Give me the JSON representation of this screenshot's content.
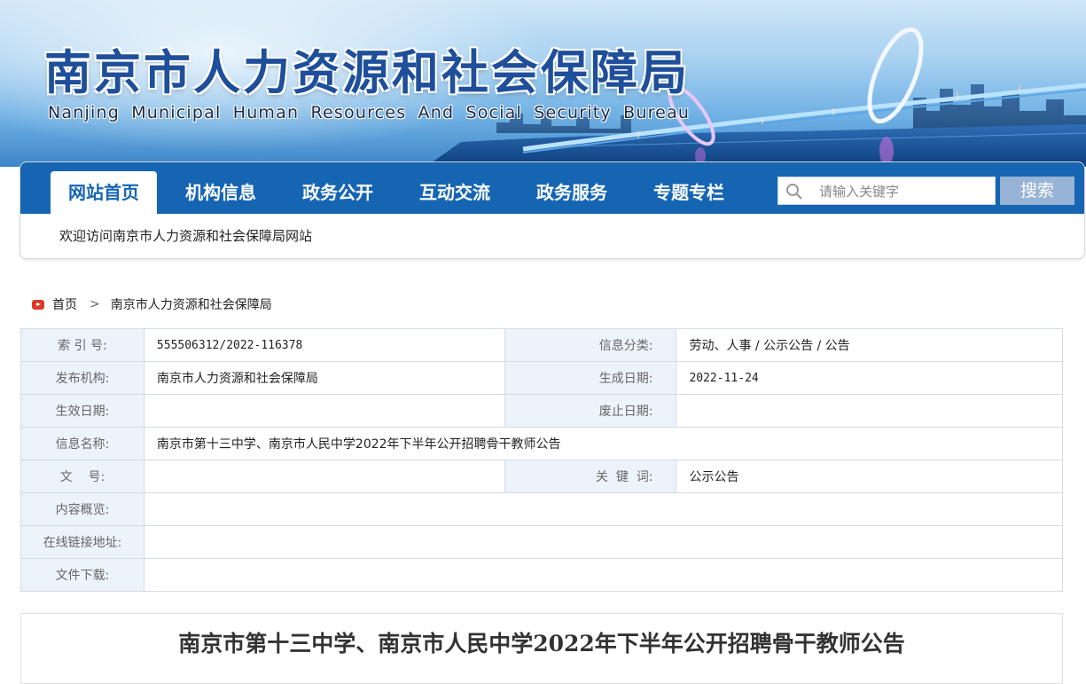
{
  "site": {
    "title_zh": "南京市人力资源和社会保障局",
    "title_en": "Nanjing Municipal Human Resources And Social Security Bureau"
  },
  "nav": {
    "items": [
      {
        "label": "网站首页",
        "active": true
      },
      {
        "label": "机构信息",
        "active": false
      },
      {
        "label": "政务公开",
        "active": false
      },
      {
        "label": "互动交流",
        "active": false
      },
      {
        "label": "政务服务",
        "active": false
      },
      {
        "label": "专题专栏",
        "active": false
      }
    ],
    "search_placeholder": "请输入关键字",
    "search_button": "搜索",
    "welcome": "欢迎访问南京市人力资源和社会保障局网站"
  },
  "breadcrumb": {
    "home": "首页",
    "separator": ">",
    "current": "南京市人力资源和社会保障局"
  },
  "meta": {
    "index_label": "索  引  号:",
    "index_value": "555506312/2022-116378",
    "category_label": "信息分类:",
    "category_value": "劳动、人事 / 公示公告 / 公告",
    "publisher_label": "发布机构:",
    "publisher_value": "南京市人力资源和社会保障局",
    "created_label": "生成日期:",
    "created_value": "2022-11-24",
    "effective_label": "生效日期:",
    "effective_value": "",
    "expiry_label": "废止日期:",
    "expiry_value": "",
    "name_label": "信息名称:",
    "name_value": "南京市第十三中学、南京市人民中学2022年下半年公开招聘骨干教师公告",
    "docno_label": "文    号:",
    "docno_value": "",
    "keywords_label": "关  键  词:",
    "keywords_value": "公示公告",
    "summary_label": "内容概览:",
    "summary_value": "",
    "link_label": "在线链接地址:",
    "link_value": "",
    "download_label": "文件下载:",
    "download_value": ""
  },
  "article": {
    "title": "南京市第十三中学、南京市人民中学2022年下半年公开招聘骨干教师公告"
  },
  "colors": {
    "nav_blue": "#1665b3",
    "label_bg": "#edf3fb",
    "search_btn": "#97b3d5"
  }
}
